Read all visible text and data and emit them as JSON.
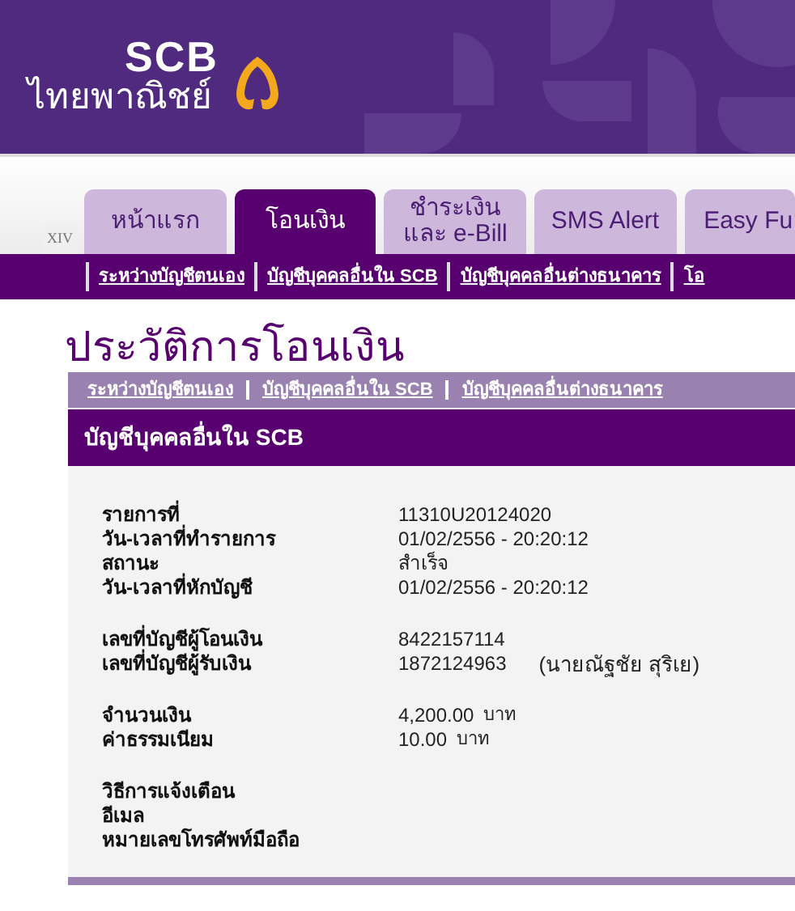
{
  "brand": {
    "name": "SCB",
    "subtitle": "ไทยพาณิชย์"
  },
  "tab_strip": {
    "marker": "XIV",
    "tabs": [
      {
        "label": "หน้าแรก",
        "selected": false
      },
      {
        "label": "โอนเงิน",
        "selected": true
      },
      {
        "label": "ชำระเงิน\nและ e-Bill",
        "selected": false
      },
      {
        "label": "SMS Alert",
        "selected": false
      },
      {
        "label": "Easy Fu",
        "selected": false
      }
    ]
  },
  "submenu": [
    "ระหว่างบัญชีตนเอง",
    "บัญชีบุคคลอื่นใน SCB",
    "บัญชีบุคคลอื่นต่างธนาคาร",
    "โอ"
  ],
  "page_title": "ประวัติการโอนเงิน",
  "subnav": [
    "ระหว่างบัญชีตนเอง",
    "บัญชีบุคคลอื่นใน SCB",
    "บัญชีบุคคลอื่นต่างธนาคาร"
  ],
  "section_title": "บัญชีบุคคลอื่นใน SCB",
  "detail_groups": [
    [
      {
        "label": "รายการที่",
        "value": "11310U20124020"
      },
      {
        "label": "วัน-เวลาที่ทำรายการ",
        "value": "01/02/2556 - 20:20:12"
      },
      {
        "label": "สถานะ",
        "value": "สำเร็จ"
      },
      {
        "label": "วัน-เวลาที่หักบัญชี",
        "value": "01/02/2556 - 20:20:12"
      }
    ],
    [
      {
        "label": "เลขที่บัญชีผู้โอนเงิน",
        "value": "8422157114"
      },
      {
        "label": "เลขที่บัญชีผู้รับเงิน",
        "value": "1872124963",
        "note": "(นายณัฐชัย สุริเย)"
      }
    ],
    [
      {
        "label": "จำนวนเงิน",
        "value": "4,200.00",
        "unit": "บาท"
      },
      {
        "label": "ค่าธรรมเนียม",
        "value": "10.00",
        "unit": "บาท"
      }
    ],
    [
      {
        "label": "วิธีการแจ้งเตือน"
      },
      {
        "label": "อีเมล"
      },
      {
        "label": "หมายเลขโทรศัพท์มือถือ"
      }
    ]
  ]
}
